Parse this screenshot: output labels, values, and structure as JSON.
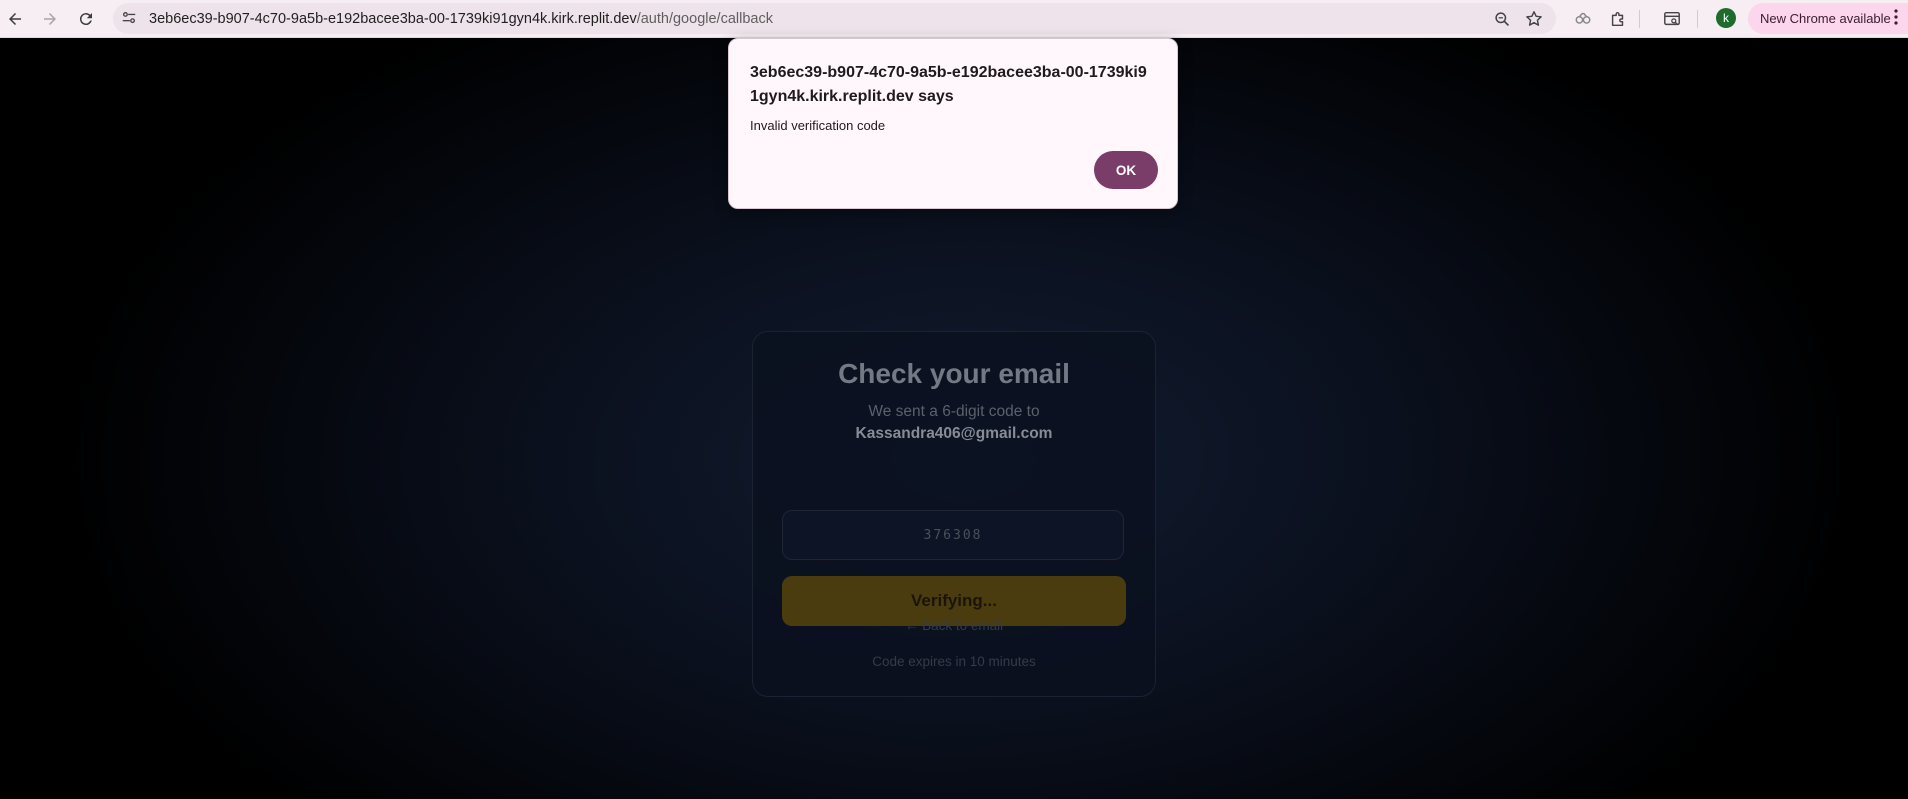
{
  "browser": {
    "url_host": "3eb6ec39-b907-4c70-9a5b-e192bacee3ba-00-1739ki91gyn4k.kirk.replit.dev",
    "url_path": "/auth/google/callback",
    "avatar_letter": "k",
    "new_chrome_label": "New Chrome available",
    "icons": {
      "back": "back-arrow-icon",
      "forward": "forward-arrow-icon",
      "reload": "reload-icon",
      "site_info": "site-info-icon",
      "zoom": "zoom-icon",
      "bookmark": "star-icon",
      "performance": "performance-icon",
      "extensions": "extensions-icon",
      "tab_search": "tab-search-icon",
      "menu": "kebab-menu-icon"
    }
  },
  "dialog": {
    "title": "3eb6ec39-b907-4c70-9a5b-e192bacee3ba-00-1739ki91gyn4k.kirk.replit.dev says",
    "message": "Invalid verification code",
    "ok_label": "OK",
    "accent_color": "#7a3c68"
  },
  "card": {
    "title": "Check your email",
    "subtitle": "We sent a 6-digit code to",
    "email": "Kassandra406@gmail.com",
    "code_value": "376308",
    "verify_label": "Verifying...",
    "back_label": "← Back to email",
    "expires_text": "Code expires in 10 minutes",
    "button_color": "#4b3c10"
  }
}
